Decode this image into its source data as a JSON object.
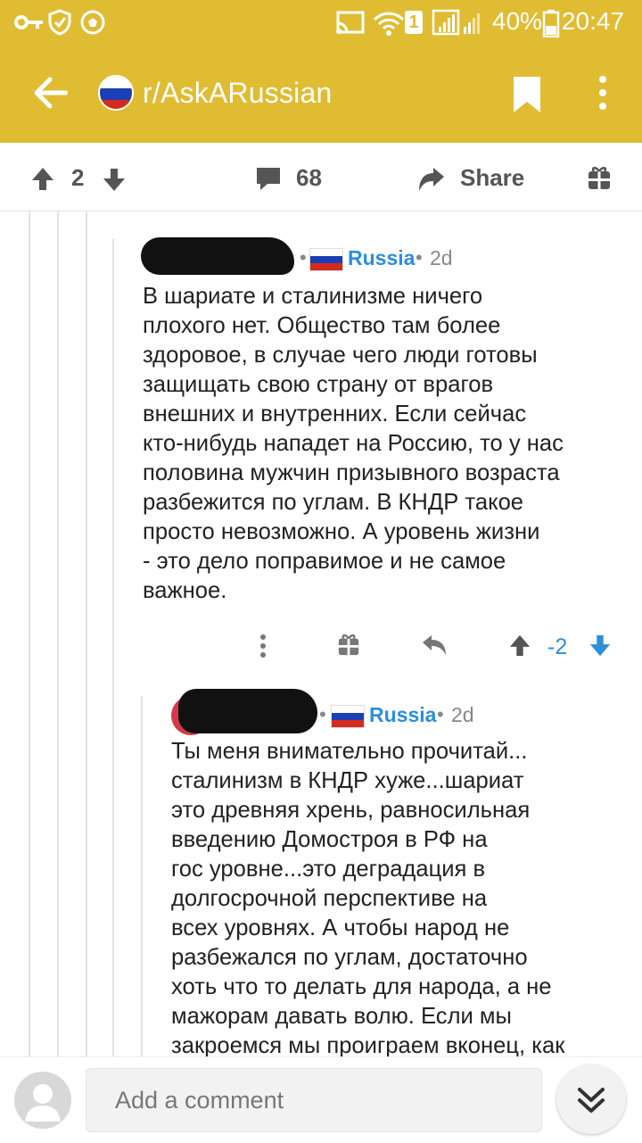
{
  "status_bar": {
    "battery_pct": "40%",
    "time": "20:47",
    "sim_badge": "1",
    "icons": [
      "key-icon",
      "shield-check-icon",
      "soccer-ball-icon",
      "cast-icon",
      "wifi-icon",
      "signal-icon",
      "battery-icon"
    ]
  },
  "app_bar": {
    "subreddit": "r/AskARussian",
    "icons": [
      "back-arrow-icon",
      "russian-flag-avatar",
      "bookmark-icon",
      "overflow-menu-icon"
    ]
  },
  "post_actions": {
    "score": "2",
    "comments": "68",
    "share": "Share"
  },
  "comments": [
    {
      "flair": "Russia",
      "time": "2d",
      "body": "В шариате и сталинизме ничего\nплохого нет. Общество там более\nздоровое, в случае чего люди готовы\nзащищать свою страну от врагов\nвнешних и внутренних. Если сейчас\nкто-нибудь нападет на Россию, то у нас\nполовина мужчин призывного возраста\nразбежится по углам. В КНДР такое\nпросто невозможно. А уровень жизни\n- это дело поправимое и не самое\nважное.",
      "score": "-2"
    },
    {
      "flair": "Russia",
      "time": "2d",
      "body": "Ты меня внимательно прочитай...\nсталинизм в КНДР хуже...шариат\nэто древняя хрень, равносильная\nвведению Домостроя в РФ на\nгос уровне...это деградация в\nдолгосрочной перспективе на\nвсех уровнях. А чтобы народ не\nразбежался по углам, достаточно\nхоть что то делать для народа, а не\nмажорам давать волю. Если мы\nзакроемся мы проиграем вконец, как"
    }
  ],
  "comment_input": {
    "placeholder": "Add a comment"
  },
  "colors": {
    "app_bar": "#e0bc33",
    "flair": "#2d8ed9",
    "downvote": "#2d8ed9",
    "text": "#222222"
  }
}
